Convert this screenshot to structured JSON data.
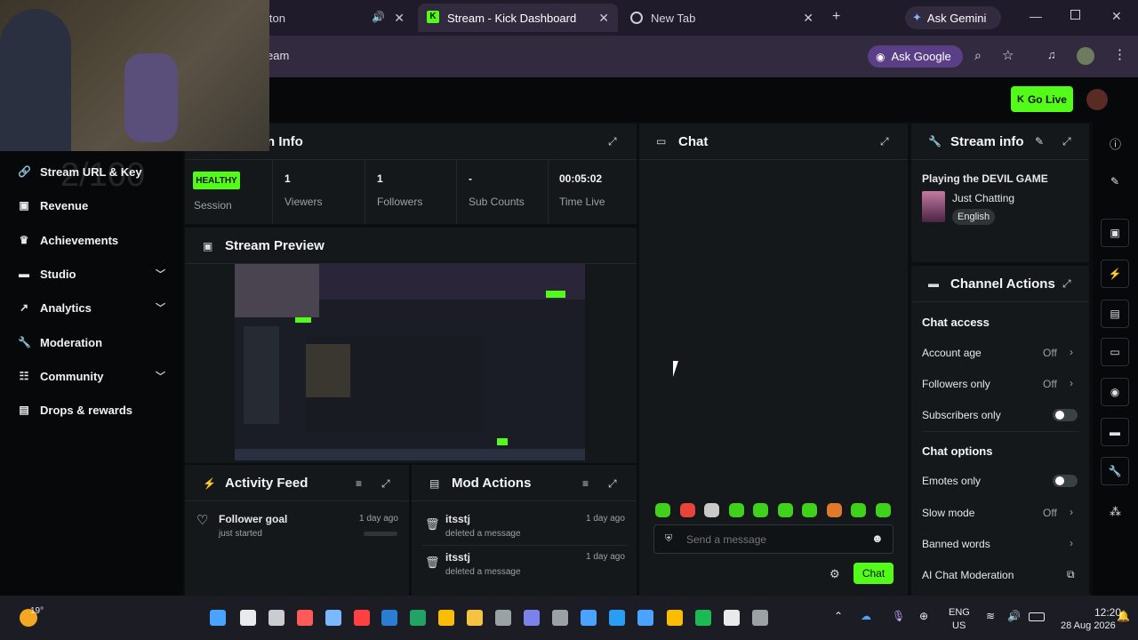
{
  "browser": {
    "tabs": [
      {
        "label": "lton",
        "active": false,
        "audio": true
      },
      {
        "label": "Stream - Kick Dashboard",
        "active": true
      },
      {
        "label": "New Tab",
        "active": false
      }
    ],
    "ask_gemini": "Ask Gemini",
    "address_text": "eam",
    "ask_google": "Ask Google"
  },
  "topbar": {
    "go_live": "Go Live"
  },
  "sidebar": {
    "items": [
      {
        "label": "Stream URL & Key",
        "icon": "link-icon",
        "chevron": false
      },
      {
        "label": "Revenue",
        "icon": "dollar-icon",
        "chevron": false
      },
      {
        "label": "Achievements",
        "icon": "trophy-icon",
        "chevron": false
      },
      {
        "label": "Studio",
        "icon": "studio-icon",
        "chevron": true
      },
      {
        "label": "Analytics",
        "icon": "analytics-icon",
        "chevron": true
      },
      {
        "label": "Moderation",
        "icon": "wrench-icon",
        "chevron": false
      },
      {
        "label": "Community",
        "icon": "community-icon",
        "chevron": true
      },
      {
        "label": "Drops & rewards",
        "icon": "gift-icon",
        "chevron": false
      }
    ],
    "overlay_counter": "2/100"
  },
  "session_info": {
    "title": "n Info",
    "status": "HEALTHY",
    "status_label": "Session",
    "stats": [
      {
        "value": "1",
        "label": "Viewers"
      },
      {
        "value": "1",
        "label": "Followers"
      },
      {
        "value": "-",
        "label": "Sub Counts"
      },
      {
        "value": "00:05:02",
        "label": "Time Live"
      }
    ]
  },
  "stream_preview": {
    "title": "Stream Preview"
  },
  "activity_feed": {
    "title": "Activity Feed",
    "items": [
      {
        "title": "Follower goal",
        "sub": "just started",
        "time": "1 day ago",
        "progress": 0
      }
    ]
  },
  "mod_actions": {
    "title": "Mod Actions",
    "items": [
      {
        "user": "itsstj",
        "action": "deleted a message",
        "time": "1 day ago"
      },
      {
        "user": "itsstj",
        "action": "deleted a message",
        "time": "1 day ago"
      }
    ]
  },
  "chat": {
    "title": "Chat",
    "placeholder": "Send a message",
    "send_label": "Chat",
    "emote_colors": [
      "#3fd11c",
      "#e8443a",
      "#c9c9c9",
      "#3fd11c",
      "#3fd11c",
      "#3fd11c",
      "#3fd11c",
      "#e07a2a",
      "#3fd11c",
      "#3fd11c"
    ]
  },
  "stream_info": {
    "title": "Stream info",
    "stream_title": "Playing the DEVIL GAME",
    "category": "Just Chatting",
    "language": "English"
  },
  "channel_actions": {
    "title": "Channel Actions",
    "chat_access_heading": "Chat access",
    "chat_access": [
      {
        "label": "Account age",
        "value": "Off",
        "type": "chevron"
      },
      {
        "label": "Followers only",
        "value": "Off",
        "type": "chevron"
      },
      {
        "label": "Subscribers only",
        "value": "",
        "type": "toggle"
      }
    ],
    "chat_options_heading": "Chat options",
    "chat_options": [
      {
        "label": "Emotes only",
        "value": "",
        "type": "toggle"
      },
      {
        "label": "Slow mode",
        "value": "Off",
        "type": "chevron"
      },
      {
        "label": "Banned words",
        "value": "",
        "type": "chevron"
      },
      {
        "label": "AI Chat Moderation",
        "value": "",
        "type": "external"
      }
    ]
  },
  "taskbar": {
    "weather_temp": "19°",
    "lang_top": "ENG",
    "lang_bottom": "US",
    "time": "12:20",
    "date": "28 Aug 2026"
  },
  "colors": {
    "kick_green": "#53fc18",
    "panel_bg": "#14181a",
    "page_bg": "#0b0e0f"
  }
}
